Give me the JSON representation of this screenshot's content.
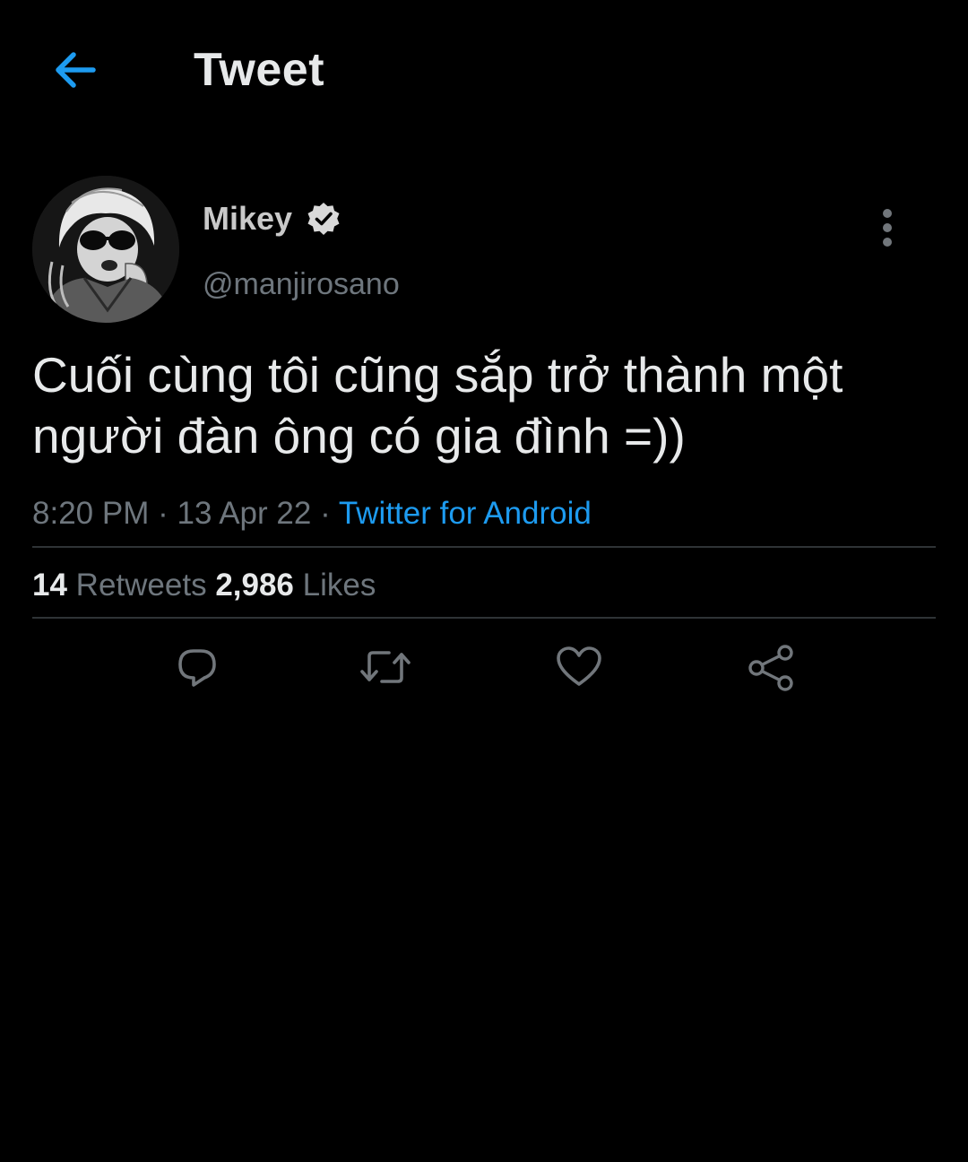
{
  "header": {
    "title": "Tweet",
    "back_icon": "arrow-left-icon",
    "accent_color": "#1d9bf0"
  },
  "author": {
    "display_name": "Mikey",
    "handle": "@manjirosano",
    "verified": true,
    "verified_icon": "verified-badge-icon",
    "more_icon": "more-vertical-icon"
  },
  "tweet": {
    "text_line1": "Cuối cùng tôi cũng sắp trở thành một",
    "text_line2": "người đàn ông có gia đình =))",
    "time": "8:20 PM",
    "separator": "·",
    "date": "13 Apr 22",
    "source": "Twitter for Android"
  },
  "stats": {
    "retweets_count": "14",
    "retweets_label": "Retweets",
    "likes_count": "2,986",
    "likes_label": "Likes"
  },
  "actions": [
    {
      "icon": "reply-icon"
    },
    {
      "icon": "retweet-icon"
    },
    {
      "icon": "like-icon"
    },
    {
      "icon": "share-icon"
    }
  ]
}
